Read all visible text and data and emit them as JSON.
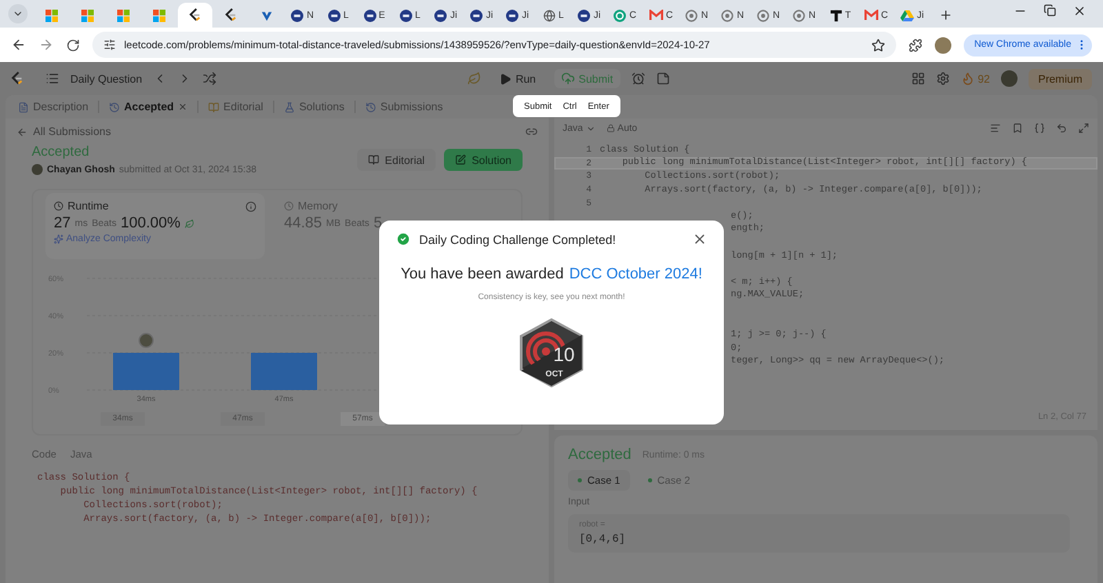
{
  "browser": {
    "tabs": [
      {
        "kind": "windows",
        "selected": false
      },
      {
        "kind": "windows",
        "selected": false
      },
      {
        "kind": "windows",
        "selected": false
      },
      {
        "kind": "windows",
        "selected": false
      },
      {
        "kind": "leetcode",
        "selected": true
      },
      {
        "kind": "leetcode",
        "selected": false
      },
      {
        "kind": "azure",
        "selected": false
      },
      {
        "kind": "circle",
        "label": "N",
        "selected": false
      },
      {
        "kind": "circle",
        "label": "L",
        "selected": false
      },
      {
        "kind": "circle",
        "label": "E",
        "selected": false
      },
      {
        "kind": "circle",
        "label": "L",
        "selected": false
      },
      {
        "kind": "circle",
        "label": "Ji",
        "selected": false
      },
      {
        "kind": "circle",
        "label": "Ji",
        "selected": false
      },
      {
        "kind": "circle",
        "label": "Ji",
        "selected": false
      },
      {
        "kind": "globe",
        "label": "L",
        "selected": false
      },
      {
        "kind": "circle",
        "label": "Ji",
        "selected": false
      },
      {
        "kind": "chatgpt",
        "label": "C",
        "selected": false
      },
      {
        "kind": "gmail",
        "label": "C",
        "selected": false
      },
      {
        "kind": "github",
        "label": "N",
        "selected": false
      },
      {
        "kind": "github",
        "label": "N",
        "selected": false
      },
      {
        "kind": "github",
        "label": "N",
        "selected": false
      },
      {
        "kind": "github",
        "label": "N",
        "selected": false
      },
      {
        "kind": "tlogo",
        "label": "T",
        "selected": false
      },
      {
        "kind": "gmail",
        "label": "C",
        "selected": false
      },
      {
        "kind": "drive",
        "label": "Ji",
        "selected": false
      }
    ],
    "url": "leetcode.com/problems/minimum-total-distance-traveled/submissions/1438959526/?envType=daily-question&envId=2024-10-27",
    "update_button": "New Chrome available"
  },
  "toolbar": {
    "title": "Daily Question",
    "run": "Run",
    "submit": "Submit",
    "streak": "92",
    "premium": "Premium"
  },
  "tooltip": {
    "action": "Submit",
    "keys": [
      "Ctrl",
      "Enter"
    ]
  },
  "left_panel": {
    "tabs": [
      {
        "label": "Description",
        "kind": "description",
        "selected": false,
        "closable": false
      },
      {
        "label": "Accepted",
        "kind": "accepted",
        "selected": true,
        "closable": true
      },
      {
        "label": "Editorial",
        "kind": "editorial",
        "selected": false,
        "closable": false
      },
      {
        "label": "Solutions",
        "kind": "solutions",
        "selected": false,
        "closable": false
      },
      {
        "label": "Submissions",
        "kind": "submissions",
        "selected": false,
        "closable": false
      }
    ],
    "back_link": "All Submissions",
    "status": "Accepted",
    "author": "Chayan Ghosh",
    "submitted": "submitted at Oct 31, 2024 15:38",
    "editorial_button": "Editorial",
    "solution_button": "Solution",
    "stats": [
      {
        "label": "Runtime",
        "value": "27",
        "unit": "ms",
        "beats_label": "Beats",
        "beats": "100.00%",
        "link": "Analyze Complexity",
        "selected": true
      },
      {
        "label": "Memory",
        "value": "44.85",
        "unit": "MB",
        "beats_label": "Beats",
        "beats": "5",
        "selected": false
      }
    ],
    "chart_data": {
      "type": "bar",
      "categories": [
        "34ms",
        "47ms"
      ],
      "values": [
        20,
        20
      ],
      "ylim": [
        0,
        60
      ],
      "yticks": [
        {
          "value": 0,
          "label": "0%"
        },
        {
          "value": 20,
          "label": "20%"
        },
        {
          "value": 40,
          "label": "40%"
        },
        {
          "value": 60,
          "label": "60%"
        }
      ]
    },
    "range_labels": [
      {
        "label": "34ms",
        "selected": false
      },
      {
        "label": "47ms",
        "selected": false
      },
      {
        "label": "57ms",
        "selected": true
      }
    ],
    "code_label": "Code",
    "code_language": "Java",
    "code": [
      "class Solution {",
      "    public long minimumTotalDistance(List<Integer> robot, int[][] factory) {",
      "        Collections.sort(robot);",
      "        Arrays.sort(factory, (a, b) -> Integer.compare(a[0], b[0]));"
    ]
  },
  "editor": {
    "language": "Java",
    "mode": "Auto",
    "status": "Ln 2, Col 77",
    "lines": [
      {
        "number": "1",
        "text": "class Solution {",
        "active": false
      },
      {
        "number": "2",
        "text": "    public long minimumTotalDistance(List<Integer> robot, int[][] factory) {",
        "active": true
      },
      {
        "number": "3",
        "text": "        Collections.sort(robot);",
        "active": false
      },
      {
        "number": "4",
        "text": "        Arrays.sort(factory, (a, b) -> Integer.compare(a[0], b[0]));",
        "active": false
      },
      {
        "number": "5",
        "active": false
      }
    ],
    "covered_blocks": [
      {
        "lines": [
          "e();",
          "ength;"
        ]
      },
      {
        "lines": [
          "long[m + 1][n + 1];"
        ]
      },
      {
        "lines": [
          "< m; i++) {",
          "ng.MAX_VALUE;"
        ]
      },
      {
        "lines": [
          "1; j >= 0; j--) {",
          "0;",
          "teger, Long>> qq = new ArrayDeque<>();"
        ]
      }
    ]
  },
  "result": {
    "status": "Accepted",
    "runtime": "Runtime: 0 ms",
    "cases": [
      {
        "label": "Case 1",
        "selected": true
      },
      {
        "label": "Case 2",
        "selected": false
      }
    ],
    "input_label": "Input",
    "param": "robot =",
    "value": "[0,4,6]"
  },
  "modal": {
    "title": "Daily Coding Challenge Completed!",
    "award_text": "You have been awarded",
    "award_name": "DCC October 2024!",
    "subtitle": "Consistency is key, see you next month!",
    "badge_day": "10",
    "badge_month": "OCT"
  }
}
